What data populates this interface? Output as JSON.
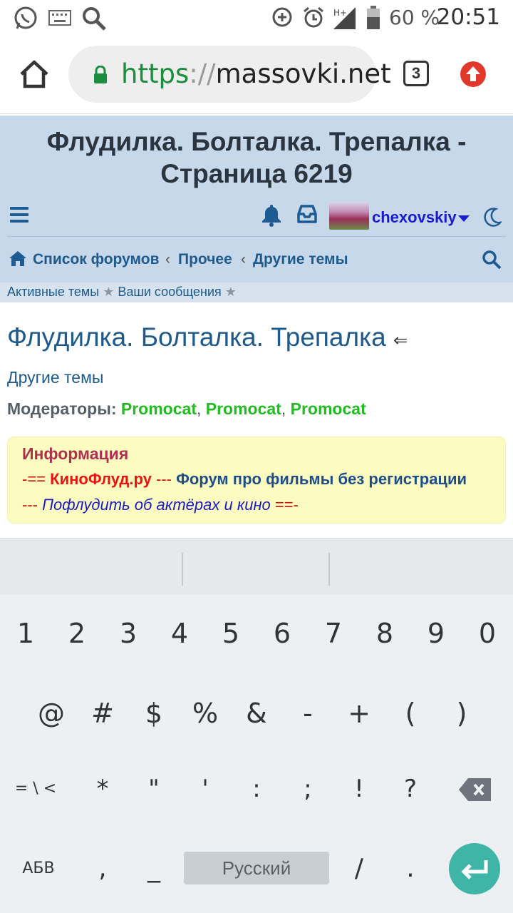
{
  "status_bar": {
    "battery": "60 %",
    "time": "20:51",
    "network": "H+",
    "icons": [
      "whatsapp-icon",
      "keyboard-icon",
      "search-icon",
      "data-saver-icon",
      "alarm-icon",
      "signal-icon",
      "battery-icon"
    ]
  },
  "browser": {
    "url_scheme": "https",
    "url_sep": "://",
    "url_host": "massovki.net",
    "tab_count": "3"
  },
  "forum": {
    "title_line1": "Флудилка. Болталка. Трепалка -",
    "title_line2": "Страница 6219",
    "username": "chexovskiy",
    "breadcrumbs": [
      "Список форумов",
      "Прочее",
      "Другие темы"
    ],
    "breadcrumb_sep": "‹",
    "subnav": [
      "Активные темы",
      "Ваши сообщения"
    ],
    "subnav_star": "★"
  },
  "content": {
    "thread_title": "Флудилка. Болталка. Трепалка",
    "thread_arrow": "⇐",
    "subforum": "Другие темы",
    "moderators_label": "Модераторы:",
    "moderators": [
      "Promocat",
      "Promocat",
      "Promocat"
    ],
    "info": {
      "title": "Информация",
      "line1_prefix": "-== ",
      "line1_link": "КиноФлуд.ру",
      "line1_mid": " --- ",
      "line1_text": "Форум про фильмы без регистрации",
      "line2_prefix": "--- ",
      "line2_text": "Пофлудить об актёрах и кино",
      "line2_suffix": " ==-"
    }
  },
  "keyboard": {
    "row1": [
      "1",
      "2",
      "3",
      "4",
      "5",
      "6",
      "7",
      "8",
      "9",
      "0"
    ],
    "row2": [
      "@",
      "#",
      "$",
      "%",
      "&",
      "-",
      "+",
      "(",
      ")"
    ],
    "row3_mode": "= \\ <",
    "row3": [
      "*",
      "\"",
      "'",
      ":",
      ";",
      "!",
      "?"
    ],
    "row4_mode": "АБВ",
    "row4_left": [
      ",",
      "_"
    ],
    "space_label": "Русский",
    "row4_right": [
      "/",
      "."
    ],
    "colors": {
      "enter": "#3fb5a8",
      "background": "#ecf0f3"
    }
  }
}
